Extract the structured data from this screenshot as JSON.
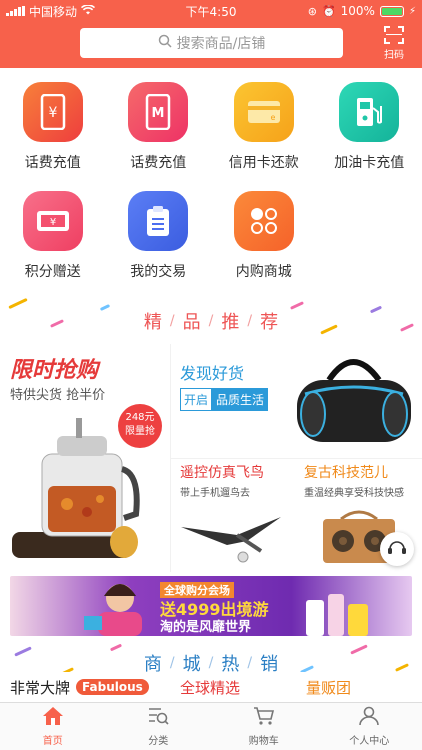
{
  "status": {
    "carrier": "中国移动",
    "time": "下午4:50",
    "battery": "100%"
  },
  "search": {
    "placeholder": "搜索商品/店铺"
  },
  "scan_label": "扫码",
  "grid": [
    {
      "label": "话费充值",
      "icon": "phone-yen-icon",
      "color": "#f05a3a"
    },
    {
      "label": "话费充值",
      "icon": "phone-m-icon",
      "color": "#f0475a"
    },
    {
      "label": "信用卡还款",
      "icon": "credit-card-icon",
      "color": "#f7b21a"
    },
    {
      "label": "加油卡充值",
      "icon": "gas-pump-icon",
      "color": "#1fc7a8"
    },
    {
      "label": "积分赠送",
      "icon": "ticket-icon",
      "color": "#f4506e"
    },
    {
      "label": "我的交易",
      "icon": "clipboard-icon",
      "color": "#4c6ef0"
    },
    {
      "label": "内购商城",
      "icon": "dots-icon",
      "color": "#f7702a"
    }
  ],
  "section1": [
    "精",
    "品",
    "推",
    "荐"
  ],
  "promo": {
    "left_title": "限时抢购",
    "left_sub": "特供尖货 抢半价",
    "price_line1": "248元",
    "price_line2": "限量抢",
    "right_title": "发现好货",
    "tag1": "开启",
    "tag2": "品质生活",
    "b1_title": "遥控仿真飞鸟",
    "b1_sub": "带上手机遛鸟去",
    "b2_title": "复古科技范儿",
    "b2_sub": "重温经典享受科技快感"
  },
  "banner": {
    "t1": "全球购分会场",
    "t2": "送4999出境游",
    "t3": "淘的是风靡世界"
  },
  "section2": [
    "商",
    "城",
    "热",
    "销"
  ],
  "bottom_row": {
    "fabulous_cn": "非常大牌",
    "fabulous_en": "Fabulous",
    "global": "全球精选",
    "group": "量贩团"
  },
  "tabs": [
    {
      "label": "首页",
      "icon": "home-icon"
    },
    {
      "label": "分类",
      "icon": "category-icon"
    },
    {
      "label": "购物车",
      "icon": "cart-icon"
    },
    {
      "label": "个人中心",
      "icon": "user-icon"
    }
  ],
  "colors": {
    "brand": "#f7614b",
    "accent_blue": "#2b9ad9",
    "accent_red": "#e53a3a"
  }
}
